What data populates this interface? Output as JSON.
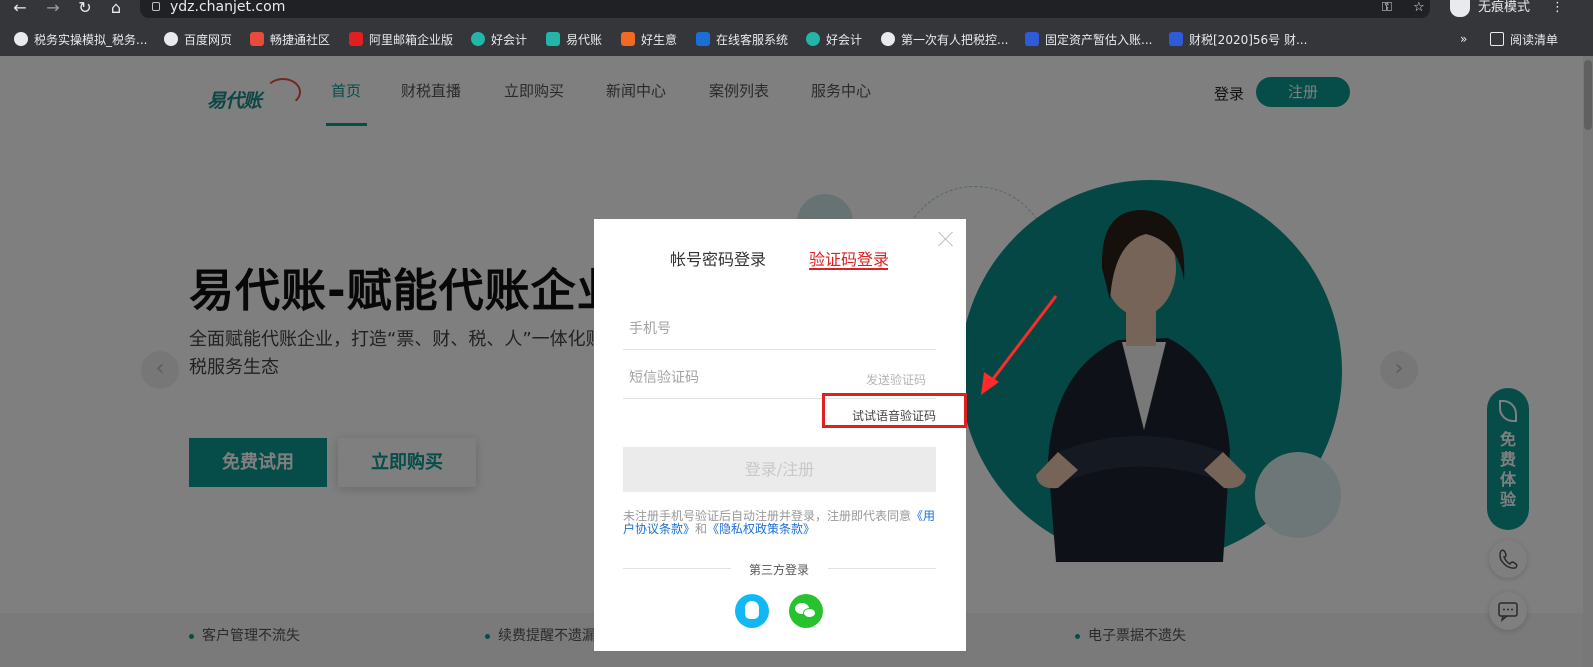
{
  "browser": {
    "url": "ydz.chanjet.com",
    "incognito_label": "无痕模式",
    "bookmarks": [
      {
        "label": "税务实操模拟_税务...",
        "icon": "globe-icon",
        "color": "#e8eaed"
      },
      {
        "label": "百度网页",
        "icon": "globe-icon",
        "color": "#e8eaed"
      },
      {
        "label": "畅捷通社区",
        "icon": "chanjet-icon",
        "color": "#e84a3c"
      },
      {
        "label": "阿里邮箱企业版",
        "icon": "mail-icon",
        "color": "#e02020"
      },
      {
        "label": "好会计",
        "icon": "cloud-icon",
        "color": "#22b5a8"
      },
      {
        "label": "易代账",
        "icon": "feather-icon",
        "color": "#22b5a8"
      },
      {
        "label": "好生意",
        "icon": "b-icon",
        "color": "#f26a21"
      },
      {
        "label": "在线客服系统",
        "icon": "u-icon",
        "color": "#1a6fd6"
      },
      {
        "label": "好会计",
        "icon": "cloud-icon",
        "color": "#22b5a8"
      },
      {
        "label": "第一次有人把税控...",
        "icon": "globe-icon",
        "color": "#e8eaed"
      },
      {
        "label": "固定资产暂估入账...",
        "icon": "baidu-icon",
        "color": "#2f5bd8"
      },
      {
        "label": "财税[2020]56号 财...",
        "icon": "doc-icon",
        "color": "#2f5bd8"
      }
    ],
    "more": "»",
    "reading_list": "阅读清单"
  },
  "site": {
    "logo_text": "易代账",
    "nav": [
      "首页",
      "财税直播",
      "立即购买",
      "新闻中心",
      "案例列表",
      "服务中心"
    ],
    "login": "登录",
    "register": "注册",
    "hero_title": "易代账-赋能代账企业",
    "hero_subtitle": "全面赋能代账企业，打造“票、财、税、人”一体化财税服务生态",
    "trial_button": "免费试用",
    "buy_button": "立即购买",
    "features": [
      "客户管理不流失",
      "续费提醒不遗漏",
      "电子票据不遗失"
    ],
    "side_trial": "免费体验",
    "brand_color": "#0d9a94"
  },
  "modal": {
    "tab_password": "帐号密码登录",
    "tab_sms": "验证码登录",
    "phone_placeholder": "手机号",
    "code_placeholder": "短信验证码",
    "send_code": "发送验证码",
    "voice_code": "试试语音验证码",
    "submit": "登录/注册",
    "agreement_prefix": "未注册手机号验证后自动注册并登录，注册即代表同意",
    "agreement_link1": "《用户协议条款》",
    "agreement_and": "和",
    "agreement_link2": "《隐私权政策条款》",
    "third_party": "第三方登录",
    "accent_color": "#e02020"
  }
}
